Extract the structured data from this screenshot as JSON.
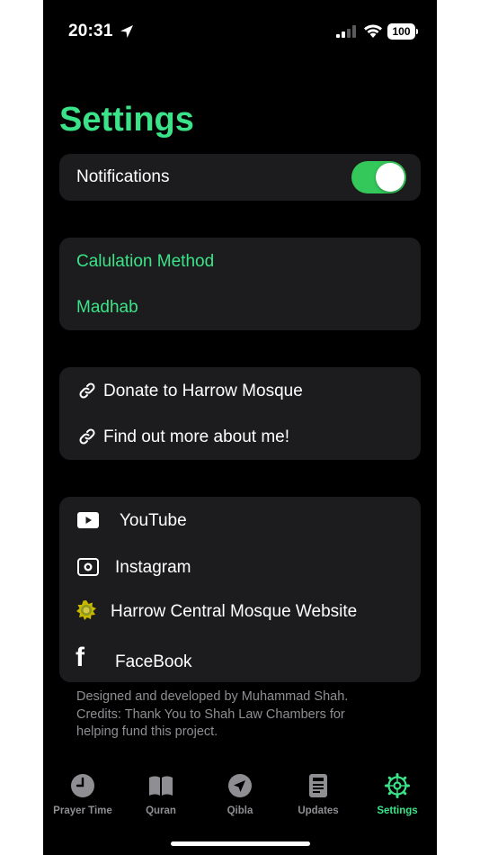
{
  "status_bar": {
    "time": "20:31",
    "battery": "100"
  },
  "page": {
    "title": "Settings"
  },
  "notifications": {
    "label": "Notifications",
    "enabled": true
  },
  "calculation": {
    "items": [
      "Calulation Method",
      "Madhab"
    ]
  },
  "links": {
    "items": [
      "Donate to Harrow Mosque",
      "Find out more about me!"
    ]
  },
  "social": {
    "youtube": "YouTube",
    "instagram": "Instagram",
    "website": "Harrow Central Mosque Website",
    "facebook": "FaceBook"
  },
  "footer": {
    "line1": "Designed and developed by Muhammad Shah.",
    "line2": "Credits: Thank You to Shah Law Chambers for",
    "line3": "helping fund this project."
  },
  "tabs": [
    {
      "label": "Prayer Time",
      "icon": "clock-icon",
      "active": false
    },
    {
      "label": "Quran",
      "icon": "book-icon",
      "active": false
    },
    {
      "label": "Qibla",
      "icon": "compass-arrow-icon",
      "active": false
    },
    {
      "label": "Updates",
      "icon": "newspaper-icon",
      "active": false
    },
    {
      "label": "Settings",
      "icon": "gear-icon",
      "active": true
    }
  ],
  "colors": {
    "accent": "#3be388",
    "toggle_on": "#34c759",
    "card_bg": "#1c1c1e",
    "inactive": "#8e8e93"
  }
}
